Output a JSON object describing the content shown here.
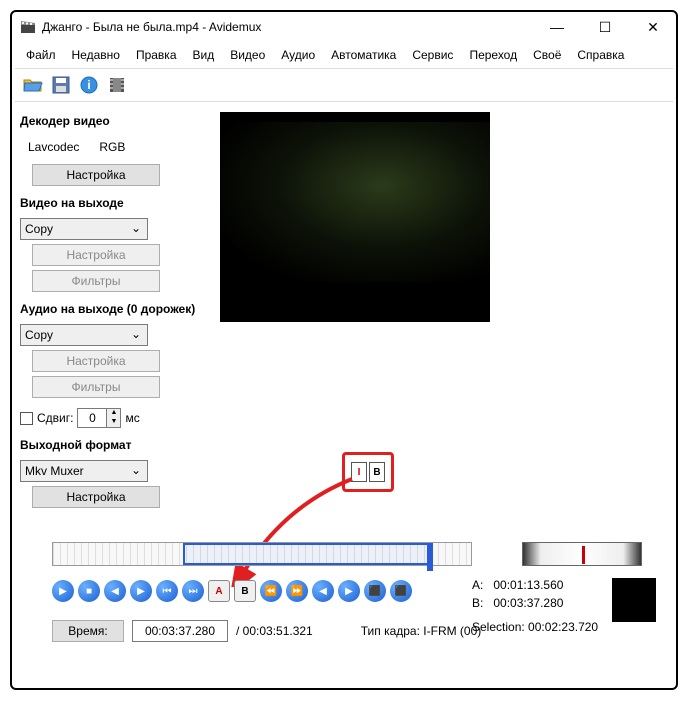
{
  "window": {
    "title": "Джанго - Была не была.mp4 - Avidemux"
  },
  "menu": {
    "file": "Файл",
    "recent": "Недавно",
    "edit": "Правка",
    "view": "Вид",
    "video": "Видео",
    "audio": "Аудио",
    "auto": "Автоматика",
    "tools": "Сервис",
    "go": "Переход",
    "custom": "Своё",
    "help": "Справка"
  },
  "toolbar": {
    "open": "open",
    "save": "save",
    "info": "info",
    "film": "film"
  },
  "decoder": {
    "label": "Декодер видео",
    "codec": "Lavcodec",
    "mode": "RGB",
    "configure": "Настройка"
  },
  "video_out": {
    "label": "Видео на выходе",
    "value": "Copy",
    "configure": "Настройка",
    "filters": "Фильтры"
  },
  "audio_out": {
    "label": "Аудио на выходе (0 дорожек)",
    "value": "Copy",
    "configure": "Настройка",
    "filters": "Фильтры"
  },
  "shift": {
    "label": "Сдвиг:",
    "value": "0",
    "unit": "мс"
  },
  "output_format": {
    "label": "Выходной формат",
    "value": "Mkv Muxer",
    "configure": "Настройка"
  },
  "marks": {
    "a_label": "A:",
    "a_value": "00:01:13.560",
    "b_label": "B:",
    "b_value": "00:03:37.280"
  },
  "time": {
    "button": "Время:",
    "current": "00:03:37.280",
    "total": "/ 00:03:51.321",
    "frame_type": "Тип кадра:  I-FRM (00)"
  },
  "selection": {
    "label": "Selection: 00:02:23.720"
  },
  "highlight": {
    "a": "I",
    "b": "B"
  }
}
